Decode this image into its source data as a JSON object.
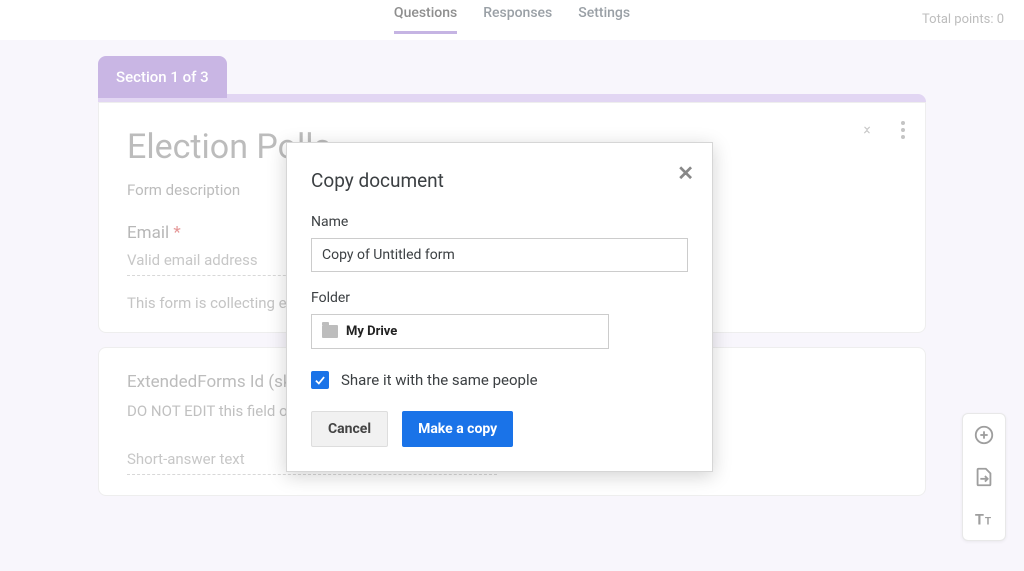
{
  "header": {
    "tabs": {
      "questions": "Questions",
      "responses": "Responses",
      "settings": "Settings"
    },
    "points_label": "Total points: 0"
  },
  "section": {
    "tab_label": "Section 1 of 3"
  },
  "form": {
    "title": "Election Polls",
    "description_ph": "Form description",
    "email_label": "Email",
    "email_required": "*",
    "email_ph": "Valid email address",
    "collecting_msg": "This form is collecting em"
  },
  "question2": {
    "title": "ExtendedForms Id (ski",
    "subtitle": "DO NOT EDIT this field o",
    "short_ph": "Short-answer text"
  },
  "modal": {
    "title": "Copy document",
    "name_label": "Name",
    "name_value": "Copy of Untitled form",
    "folder_label": "Folder",
    "folder_value": "My Drive",
    "share_label": "Share it with the same people",
    "cancel": "Cancel",
    "make_copy": "Make a copy"
  }
}
